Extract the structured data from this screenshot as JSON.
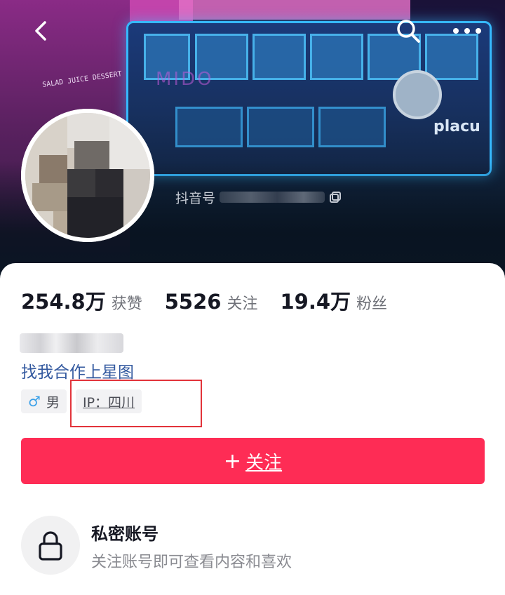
{
  "header": {
    "banner_texts": {
      "shop_sign": "SALAD JUICE DESSERT",
      "mido_sign": "MIDO",
      "place_sign": "placu"
    },
    "username_blurred": "",
    "id_label": "抖音号",
    "icons": {
      "back": "back-arrow-icon",
      "search": "search-icon",
      "more": "more-dots-icon",
      "copy": "copy-icon"
    }
  },
  "stats": [
    {
      "value": "254.8万",
      "label": "获赞"
    },
    {
      "value": "5526",
      "label": "关注"
    },
    {
      "value": "19.4万",
      "label": "粉丝"
    }
  ],
  "profile": {
    "bio_link": "找我合作上星图",
    "gender_symbol": "♂",
    "gender": "男",
    "ip_location": "IP：四川"
  },
  "follow_button": {
    "plus": "+",
    "label": "关注"
  },
  "private_account": {
    "title": "私密账号",
    "subtitle": "关注账号即可查看内容和喜欢"
  },
  "colors": {
    "accent": "#fe2c55",
    "link": "#33599f",
    "highlight_box": "#e2333a"
  }
}
